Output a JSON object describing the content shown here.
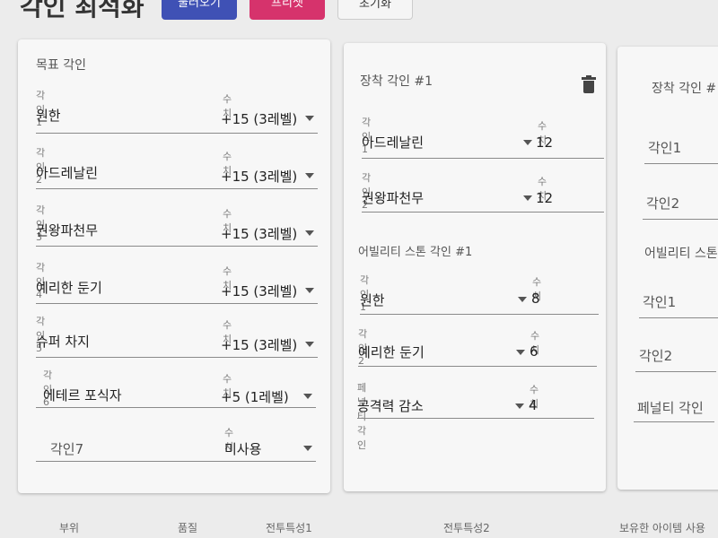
{
  "header": {
    "title": "각인 최적화",
    "save_label": "불러오기",
    "reset_label": "프리셋",
    "init_label": "초기화"
  },
  "target_panel": {
    "title": "목표 각인",
    "value_label": "수치",
    "rows": [
      {
        "label": "각인1",
        "name": "원한",
        "value": "+15 (3레벨)"
      },
      {
        "label": "각인2",
        "name": "아드레날린",
        "value": "+15 (3레벨)"
      },
      {
        "label": "각인3",
        "name": "권왕파천무",
        "value": "+15 (3레벨)"
      },
      {
        "label": "각인4",
        "name": "예리한 둔기",
        "value": "+15 (3레벨)"
      },
      {
        "label": "각인5",
        "name": "슈퍼 차지",
        "value": "+15 (3레벨)"
      },
      {
        "label": "각인6",
        "name": "에테르 포식자",
        "value": "+5 (1레벨)"
      },
      {
        "label": "",
        "name": "각인7",
        "value": "미사용"
      }
    ]
  },
  "equip_panel": {
    "title": "장착 각인 #1",
    "value_label": "수치",
    "rows": [
      {
        "label": "각인1",
        "name": "아드레날린",
        "value": "12"
      },
      {
        "label": "각인2",
        "name": "권왕파천무",
        "value": "12"
      }
    ],
    "stone_title": "어빌리티 스톤 각인 #1",
    "stone_rows": [
      {
        "label": "각인1",
        "name": "원한",
        "value": "8"
      },
      {
        "label": "각인2",
        "name": "예리한 둔기",
        "value": "6"
      },
      {
        "label": "페널티 각인",
        "name": "공격력 감소",
        "value": "4"
      }
    ]
  },
  "equip_panel_2": {
    "title": "장착 각인 #",
    "rows": [
      "각인1",
      "각인2"
    ],
    "stone_title": "어빌리티 스톤",
    "stone_rows": [
      "각인1",
      "각인2",
      "페널티 각인"
    ]
  },
  "footer": {
    "col1": "부위",
    "col2": "품질",
    "col3": "전투특성1",
    "col4": "전투특성2",
    "col5": "보유한 아이템 사용"
  },
  "icons": {
    "delete": "trash-icon",
    "dropdown": "caret-down-icon"
  }
}
